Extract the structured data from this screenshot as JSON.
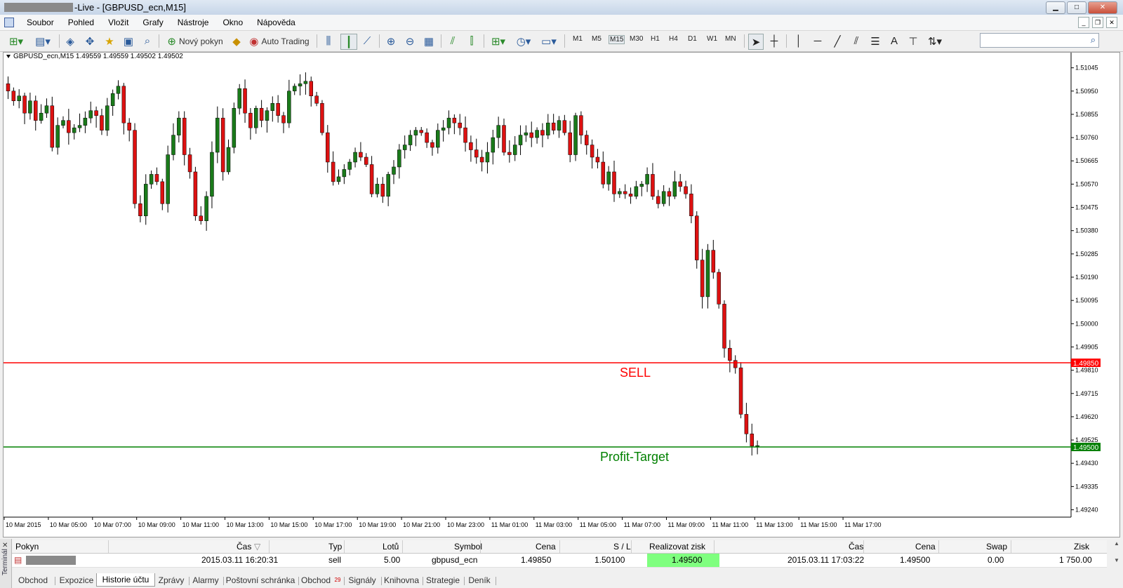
{
  "window": {
    "title": "-Live - [GBPUSD_ecn,M15]",
    "controls": [
      "minimize",
      "maximize",
      "close"
    ]
  },
  "menu": [
    "Soubor",
    "Pohled",
    "Vložit",
    "Grafy",
    "Nástroje",
    "Okno",
    "Nápověda"
  ],
  "toolbar": {
    "new_order": "Nový pokyn",
    "auto_trading": "Auto Trading",
    "timeframes": [
      "M1",
      "M5",
      "M15",
      "M30",
      "H1",
      "H4",
      "D1",
      "W1",
      "MN"
    ],
    "active_timeframe": "M15",
    "search_placeholder": ""
  },
  "chart": {
    "header": "GBPUSD_ecn,M15  1.49559 1.49559 1.49502 1.49502",
    "symbol": "GBPUSD_ecn",
    "timeframe": "M15",
    "ohlc": [
      1.49559,
      1.49559,
      1.49502,
      1.49502
    ],
    "sell_label": "SELL",
    "target_label": "Profit-Target",
    "sell_price": "1.49850",
    "target_price": "1.49500",
    "colors": {
      "bull": "#1a7a1a",
      "bear": "#dd1111",
      "sell_line": "#ff0000",
      "target_line": "#008000"
    }
  },
  "chart_data": {
    "type": "candlestick",
    "symbol": "GBPUSD_ecn",
    "timeframe": "M15",
    "ylim": [
      1.4924,
      1.5107
    ],
    "y_ticks": [
      "1.51045",
      "1.50950",
      "1.50855",
      "1.50760",
      "1.50665",
      "1.50570",
      "1.50475",
      "1.50380",
      "1.50285",
      "1.50190",
      "1.50095",
      "1.50000",
      "1.49905",
      "1.49810",
      "1.49715",
      "1.49620",
      "1.49525",
      "1.49430",
      "1.49335",
      "1.49240"
    ],
    "x_ticks": [
      "10 Mar 2015",
      "10 Mar 05:00",
      "10 Mar 07:00",
      "10 Mar 09:00",
      "10 Mar 11:00",
      "10 Mar 13:00",
      "10 Mar 15:00",
      "10 Mar 17:00",
      "10 Mar 19:00",
      "10 Mar 21:00",
      "10 Mar 23:00",
      "11 Mar 01:00",
      "11 Mar 03:00",
      "11 Mar 05:00",
      "11 Mar 07:00",
      "11 Mar 09:00",
      "11 Mar 11:00",
      "11 Mar 13:00",
      "11 Mar 15:00",
      "11 Mar 17:00"
    ],
    "horizontal_lines": [
      {
        "label": "SELL",
        "price": 1.4985,
        "color": "#ff0000"
      },
      {
        "label": "Profit-Target",
        "price": 1.495,
        "color": "#008000"
      }
    ],
    "last_close": 1.49502,
    "closes": [
      1.5095,
      1.5091,
      1.5093,
      1.5086,
      1.5091,
      1.5083,
      1.5086,
      1.5089,
      1.5072,
      1.5081,
      1.5083,
      1.5078,
      1.508,
      1.5081,
      1.5084,
      1.5087,
      1.5085,
      1.5079,
      1.5089,
      1.5094,
      1.5097,
      1.5082,
      1.5079,
      1.5049,
      1.5044,
      1.5057,
      1.5061,
      1.5058,
      1.5049,
      1.5069,
      1.5077,
      1.5084,
      1.5069,
      1.5062,
      1.5044,
      1.5042,
      1.5052,
      1.507,
      1.5084,
      1.5062,
      1.5072,
      1.5088,
      1.5096,
      1.5086,
      1.508,
      1.5088,
      1.5083,
      1.5087,
      1.509,
      1.5085,
      1.5082,
      1.5095,
      1.5097,
      1.5098,
      1.5099,
      1.5093,
      1.509,
      1.5078,
      1.5066,
      1.5058,
      1.506,
      1.5063,
      1.5066,
      1.507,
      1.5068,
      1.5065,
      1.5053,
      1.5057,
      1.5052,
      1.5061,
      1.5064,
      1.5071,
      1.5073,
      1.5077,
      1.5079,
      1.5078,
      1.5074,
      1.5072,
      1.5079,
      1.508,
      1.5084,
      1.5082,
      1.508,
      1.5074,
      1.5071,
      1.5068,
      1.5066,
      1.507,
      1.5076,
      1.5081,
      1.507,
      1.5069,
      1.5073,
      1.5077,
      1.5078,
      1.5076,
      1.5079,
      1.5077,
      1.5082,
      1.5079,
      1.5083,
      1.5078,
      1.5069,
      1.5085,
      1.5077,
      1.5073,
      1.5068,
      1.5066,
      1.5057,
      1.5062,
      1.5053,
      1.5054,
      1.5053,
      1.5052,
      1.5056,
      1.5057,
      1.5061,
      1.5052,
      1.5049,
      1.5054,
      1.5052,
      1.5058,
      1.5056,
      1.5053,
      1.5044,
      1.5026,
      1.5011,
      1.503,
      1.5021,
      1.5008,
      1.499,
      1.4985,
      1.4982,
      1.4963,
      1.4955,
      1.495,
      1.49502
    ],
    "series": [
      {
        "name": "GBPUSD_ecn,M15",
        "ohlc_last": [
          1.49559,
          1.49559,
          1.49502,
          1.49502
        ]
      }
    ]
  },
  "terminal": {
    "side_label": "Terminál",
    "columns": [
      "Pokyn",
      "Čas",
      "Typ",
      "Lotů",
      "Symbol",
      "Cena",
      "S / L",
      "Realizovat zisk",
      "Čas",
      "Cena",
      "Swap",
      "Zisk"
    ],
    "row": {
      "pokyn": "",
      "open_time": "2015.03.11 16:20:31",
      "type": "sell",
      "lots": "5.00",
      "symbol": "gbpusd_ecn",
      "price": "1.49850",
      "sl": "1.50100",
      "tp": "1.49500",
      "close_time": "2015.03.11 17:03:22",
      "close_price": "1.49500",
      "swap": "0.00",
      "profit": "1 750.00"
    },
    "tabs": [
      "Obchod",
      "Expozice",
      "Historie účtu",
      "Zprávy",
      "Alarmy",
      "Poštovní schránka",
      "Obchod",
      "Signály",
      "Knihovna",
      "Strategie",
      "Deník"
    ],
    "selected_tab": "Historie účtu",
    "badge": "29"
  }
}
